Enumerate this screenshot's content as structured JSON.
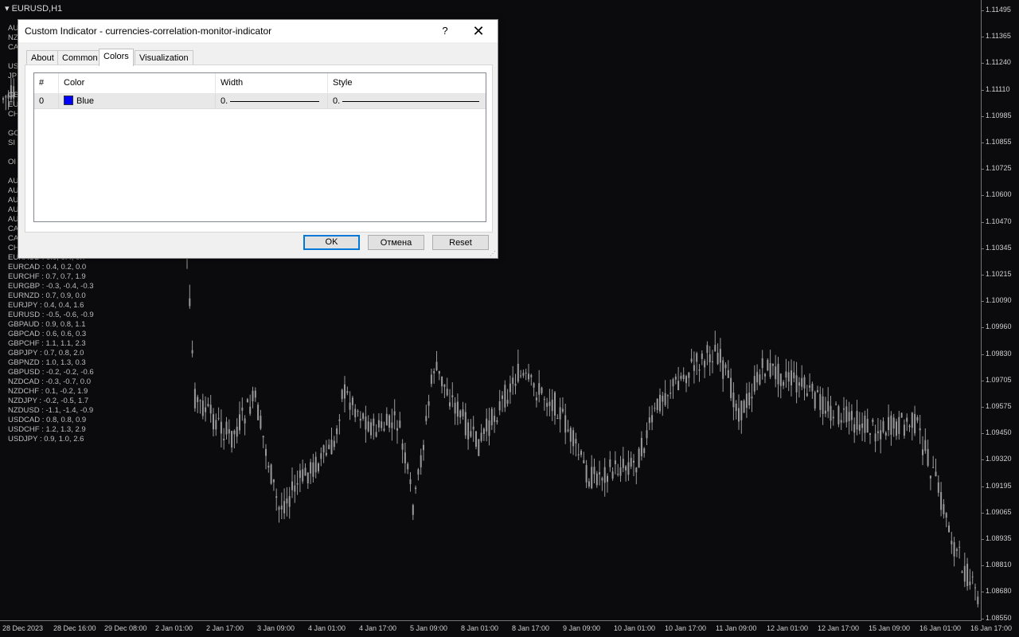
{
  "chart": {
    "symbol": "EURUSD,H1",
    "price_labels": [
      "1.11495",
      "1.11365",
      "1.11240",
      "1.11110",
      "1.10985",
      "1.10855",
      "1.10725",
      "1.10600",
      "1.10470",
      "1.10345",
      "1.10215",
      "1.10090",
      "1.09960",
      "1.09830",
      "1.09705",
      "1.09575",
      "1.09450",
      "1.09320",
      "1.09195",
      "1.09065",
      "1.08935",
      "1.08810",
      "1.08680",
      "1.08550"
    ],
    "time_labels": [
      "28 Dec 2023",
      "28 Dec 16:00",
      "29 Dec 08:00",
      "2 Jan 01:00",
      "2 Jan 17:00",
      "3 Jan 09:00",
      "4 Jan 01:00",
      "4 Jan 17:00",
      "5 Jan 09:00",
      "8 Jan 01:00",
      "8 Jan 17:00",
      "9 Jan 09:00",
      "10 Jan 01:00",
      "10 Jan 17:00",
      "11 Jan 09:00",
      "12 Jan 01:00",
      "12 Jan 17:00",
      "15 Jan 09:00",
      "16 Jan 01:00",
      "16 Jan 17:00"
    ],
    "hidden_prefixes": [
      "AU",
      "NZ",
      "CA",
      "",
      "US",
      "JP",
      "",
      "GB",
      "EU",
      "CH",
      "",
      "GO",
      "SI",
      "",
      "OI",
      "",
      "AU",
      "AU",
      "AU",
      "AU",
      "AU",
      "CA",
      "CA",
      "CH"
    ],
    "correlations": [
      "EURAUD : 0.0, 0.4, 0.7",
      "EURCAD : 0.4, 0.2, 0.0",
      "EURCHF : 0.7, 0.7, 1.9",
      "EURGBP : -0.3, -0.4, -0.3",
      "EURNZD : 0.7, 0.9, 0.0",
      "EURJPY : 0.4, 0.4, 1.6",
      "EURUSD : -0.5, -0.6, -0.9",
      "GBPAUD : 0.9, 0.8, 1.1",
      "GBPCAD : 0.6, 0.6, 0.3",
      "GBPCHF : 1.1, 1.1, 2.3",
      "GBPJPY : 0.7, 0.8, 2.0",
      "GBPNZD : 1.0, 1.3, 0.3",
      "GBPUSD : -0.2, -0.2, -0.6",
      "NZDCAD : -0.3, -0.7, 0.0",
      "NZDCHF : 0.1, -0.2, 1.9",
      "NZDJPY : -0.2, -0.5, 1.7",
      "NZDUSD : -1.1, -1.4, -0.9",
      "USDCAD : 0.8, 0.8, 0.9",
      "USDCHF : 1.2, 1.3, 2.9",
      "USDJPY : 0.9, 1.0, 2.6"
    ]
  },
  "dialog": {
    "title": "Custom Indicator - currencies-correlation-monitor-indicator",
    "help": "?",
    "close": "✕",
    "tabs": [
      "About",
      "Common",
      "Colors",
      "Visualization"
    ],
    "active_tab": "Colors",
    "columns": [
      "#",
      "Color",
      "Width",
      "Style"
    ],
    "rows": [
      {
        "index": "0",
        "color_name": "Blue",
        "color_hex": "#0000ff",
        "width": "0.",
        "style": "0."
      }
    ],
    "buttons": {
      "ok": "OK",
      "cancel": "Отмена",
      "reset": "Reset"
    }
  },
  "colors": {
    "background": "#0b0b0e",
    "candles": "#9a9a9a"
  }
}
